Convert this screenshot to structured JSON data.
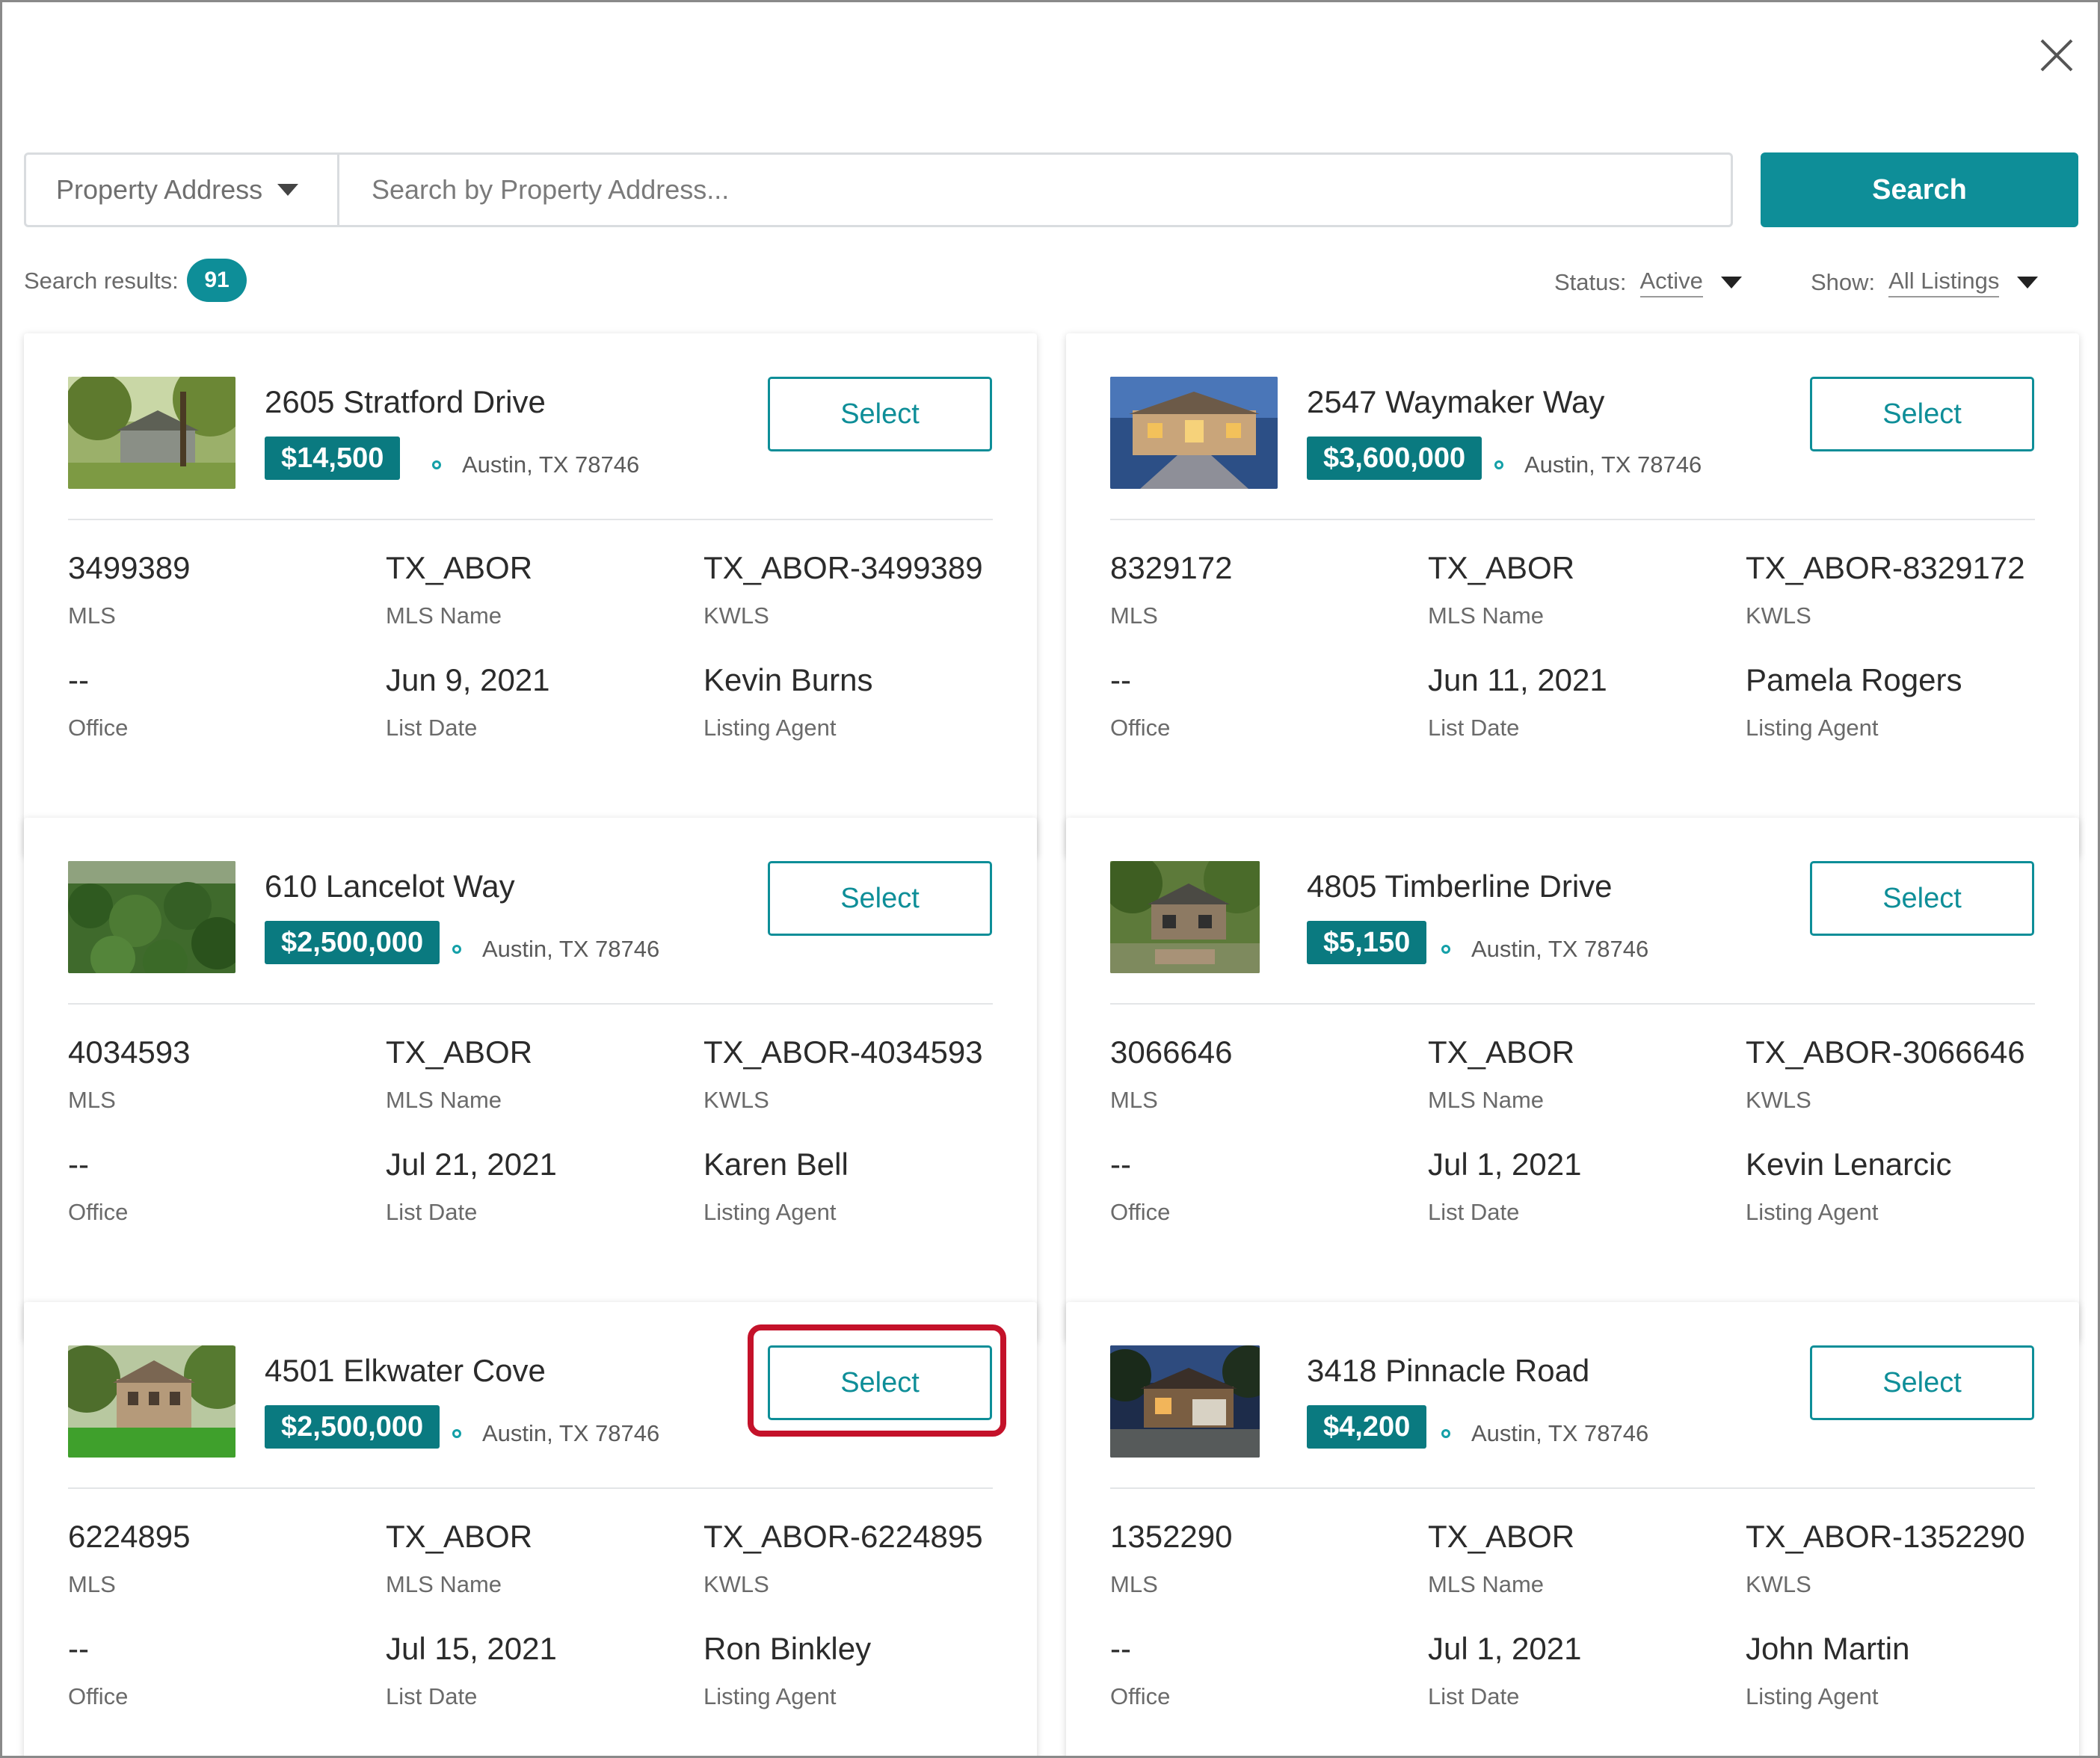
{
  "search": {
    "field_label": "Property Address",
    "placeholder": "Search by Property Address...",
    "button_label": "Search"
  },
  "results": {
    "label": "Search results:",
    "count": "91"
  },
  "filters": {
    "status_label": "Status:",
    "status_value": "Active",
    "show_label": "Show:",
    "show_value": "All Listings"
  },
  "labels": {
    "mls": "MLS",
    "mls_name": "MLS Name",
    "kwls": "KWLS",
    "office": "Office",
    "list_date": "List Date",
    "listing_agent": "Listing Agent",
    "select": "Select"
  },
  "listings": [
    {
      "address": "2605 Stratford Drive",
      "price": "$14,500",
      "city": "Austin, TX 78746",
      "mls": "3499389",
      "mls_name": "TX_ABOR",
      "kwls": "TX_ABOR-3499389",
      "office": "--",
      "list_date": "Jun 9, 2021",
      "agent": "Kevin Burns",
      "image": "wooded-house-photo"
    },
    {
      "address": "2547 Waymaker Way",
      "price": "$3,600,000",
      "city": "Austin, TX 78746",
      "mls": "8329172",
      "mls_name": "TX_ABOR",
      "kwls": "TX_ABOR-8329172",
      "office": "--",
      "list_date": "Jun 11, 2021",
      "agent": "Pamela Rogers",
      "image": "lit-mansion-dusk-photo"
    },
    {
      "address": "610 Lancelot Way",
      "price": "$2,500,000",
      "city": "Austin, TX 78746",
      "mls": "4034593",
      "mls_name": "TX_ABOR",
      "kwls": "TX_ABOR-4034593",
      "office": "--",
      "list_date": "Jul 21, 2021",
      "agent": "Karen Bell",
      "image": "aerial-trees-photo"
    },
    {
      "address": "4805 Timberline Drive",
      "price": "$5,150",
      "city": "Austin, TX 78746",
      "mls": "3066646",
      "mls_name": "TX_ABOR",
      "kwls": "TX_ABOR-3066646",
      "office": "--",
      "list_date": "Jul 1, 2021",
      "agent": "Kevin Lenarcic",
      "image": "stone-house-garden-photo"
    },
    {
      "address": "4501 Elkwater Cove",
      "price": "$2,500,000",
      "city": "Austin, TX 78746",
      "mls": "6224895",
      "mls_name": "TX_ABOR",
      "kwls": "TX_ABOR-6224895",
      "office": "--",
      "list_date": "Jul 15, 2021",
      "agent": "Ron Binkley",
      "image": "house-lawn-photo"
    },
    {
      "address": "3418 Pinnacle Road",
      "price": "$4,200",
      "city": "Austin, TX 78746",
      "mls": "1352290",
      "mls_name": "TX_ABOR",
      "kwls": "TX_ABOR-1352290",
      "office": "--",
      "list_date": "Jul 1, 2021",
      "agent": "John Martin",
      "image": "house-night-photo"
    }
  ],
  "colors": {
    "accent": "#0e8e98",
    "price_badge": "#0a7a80",
    "highlight": "#c4122a"
  }
}
